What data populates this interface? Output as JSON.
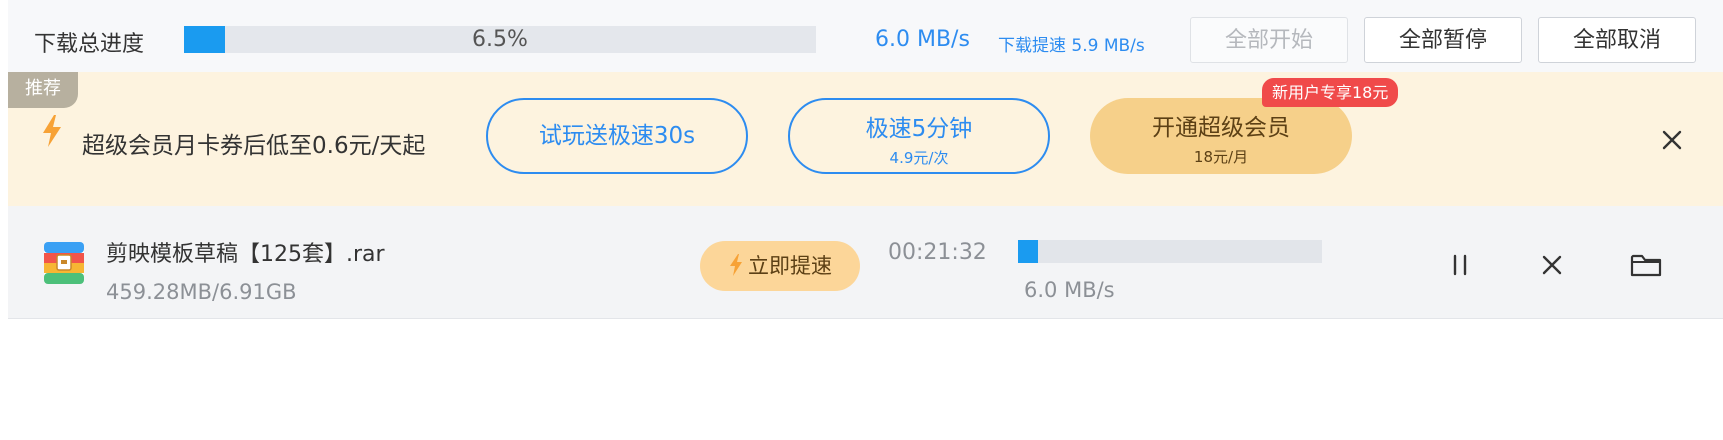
{
  "topbar": {
    "overall_label": "下载总进度",
    "overall_progress": 0.065,
    "overall_percent_text": "6.5%",
    "current_speed": "6.0 MB/s",
    "boost_speed_prefix": "下载提速",
    "boost_speed_value": "5.9 MB/s",
    "start_all_label": "全部开始",
    "pause_all_label": "全部暂停",
    "cancel_all_label": "全部取消"
  },
  "promo": {
    "tag": "推荐",
    "text": "超级会员月卡券后低至0.6元/天起",
    "trial_button": "试玩送极速30s",
    "speed5_button": "极速5分钟",
    "speed5_price": "4.9元/次",
    "vip_button": "开通超级会员",
    "vip_price": "18元/月",
    "new_user_badge": "新用户专享18元"
  },
  "download": {
    "file_name": "剪映模板草稿【125套】.rar",
    "size_text": "459.28MB/6.91GB",
    "boost_button": "立即提速",
    "time_left": "00:21:32",
    "progress": 0.065,
    "speed": "6.0 MB/s"
  },
  "icons": {
    "lightning": "lightning-icon",
    "close": "close-icon",
    "pause": "pause-icon",
    "cancel": "cancel-icon",
    "folder": "folder-icon",
    "archive": "archive-icon"
  },
  "colors": {
    "accent_blue": "#1a9bf0",
    "link_blue": "#2d8cf0",
    "promo_bg": "#fdf3df",
    "gold": "#f6d08a",
    "badge_red": "#f04a4a",
    "lightning_orange": "#f7a236"
  }
}
